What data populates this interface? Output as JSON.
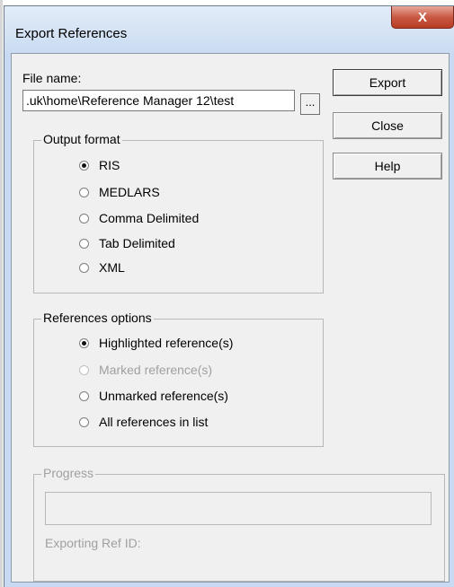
{
  "window": {
    "title": "Export References",
    "close_glyph": "X"
  },
  "file": {
    "label": "File name:",
    "value": ".uk\\home\\Reference Manager 12\\test",
    "browse_label": "..."
  },
  "buttons": {
    "export": "Export",
    "close": "Close",
    "help": "Help"
  },
  "output_format": {
    "legend": "Output format",
    "options": [
      {
        "label": "RIS",
        "checked": true,
        "enabled": true
      },
      {
        "label": "MEDLARS",
        "checked": false,
        "enabled": true
      },
      {
        "label": "Comma Delimited",
        "checked": false,
        "enabled": true
      },
      {
        "label": "Tab Delimited",
        "checked": false,
        "enabled": true
      },
      {
        "label": "XML",
        "checked": false,
        "enabled": true
      }
    ]
  },
  "references_options": {
    "legend": "References options",
    "options": [
      {
        "label": "Highlighted reference(s)",
        "checked": true,
        "enabled": true
      },
      {
        "label": "Marked reference(s)",
        "checked": false,
        "enabled": false
      },
      {
        "label": "Unmarked reference(s)",
        "checked": false,
        "enabled": true
      },
      {
        "label": "All references in list",
        "checked": false,
        "enabled": true
      }
    ]
  },
  "progress": {
    "legend": "Progress",
    "status_label": "Exporting Ref ID:",
    "value": 0
  },
  "colors": {
    "titlebar": "#c7daf1",
    "close_button": "#c95a45",
    "dialog_face": "#f0f0f0"
  }
}
